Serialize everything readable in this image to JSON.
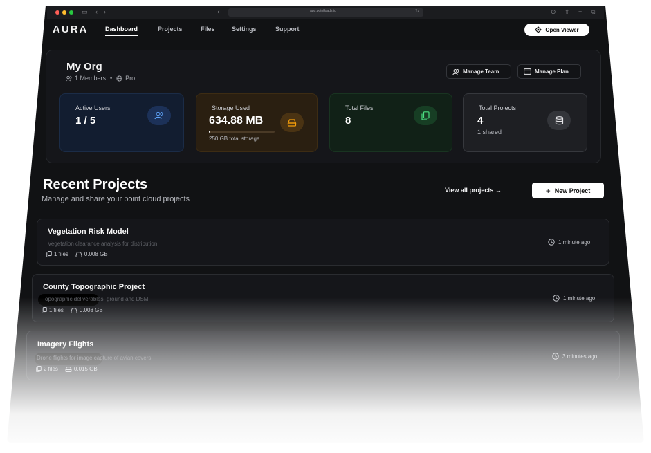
{
  "browser": {
    "url": "app.pointloads.io",
    "traffic_colors": [
      "#ff5f57",
      "#febc2e",
      "#28c840"
    ]
  },
  "nav": {
    "logo": "AURA",
    "links": [
      "Dashboard",
      "Projects",
      "Files",
      "Settings",
      "Support"
    ],
    "active": "Dashboard",
    "open_viewer_label": "Open Viewer"
  },
  "org": {
    "name": "My Org",
    "members": "1 Members",
    "separator": "•",
    "plan": "Pro",
    "manage_team_label": "Manage Team",
    "manage_plan_label": "Manage Plan"
  },
  "stats": [
    {
      "label": "Active Users",
      "value": "1 / 5",
      "icon": "users-icon",
      "accent": "#3b82f6"
    },
    {
      "label": "Storage Used",
      "value": "634.88 MB",
      "sub": "250 GB total storage",
      "usage_fraction": 0.0025,
      "icon": "hard-drive-icon",
      "accent": "#f59e0b"
    },
    {
      "label": "Total Files",
      "value": "8",
      "icon": "files-icon",
      "accent": "#22c55e"
    },
    {
      "label": "Total Projects",
      "value": "4",
      "sub": "1 shared",
      "icon": "database-icon",
      "accent": "#d4d4d8"
    }
  ],
  "recent": {
    "title": "Recent Projects",
    "subtitle": "Manage and share your point cloud projects",
    "view_all_label": "View all projects →",
    "new_project_label": "New Project",
    "projects": [
      {
        "name": "Vegetation Risk Model",
        "description": "Vegetation clearance analysis for distribution",
        "files": "1 files",
        "size": "0.008 GB",
        "time": "1 minute ago"
      },
      {
        "name": "County Topographic Project",
        "description": "Topographic deliverables, ground and DSM",
        "files": "1 files",
        "size": "0.008 GB",
        "time": "1 minute ago"
      },
      {
        "name": "Imagery Flights",
        "description": "Drone flights for image capture of avian covers",
        "files": "2 files",
        "size": "0.015 GB",
        "time": "3 minutes ago"
      }
    ]
  }
}
